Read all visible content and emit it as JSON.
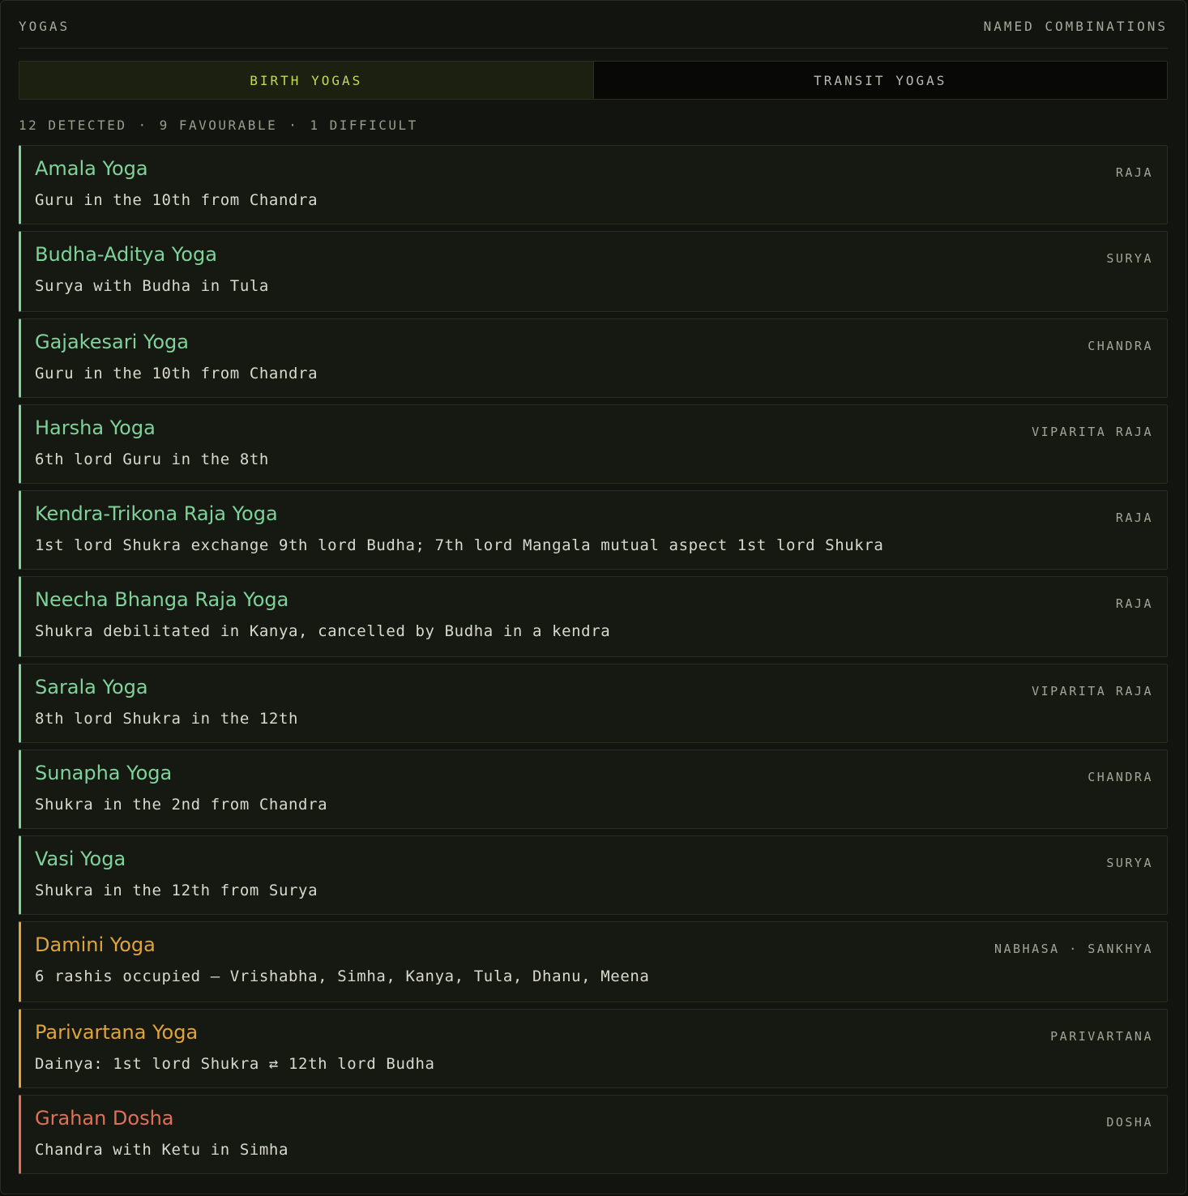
{
  "header": {
    "title": "YOGAS",
    "subtitle": "NAMED COMBINATIONS"
  },
  "tabs": [
    {
      "label": "BIRTH YOGAS",
      "active": true
    },
    {
      "label": "TRANSIT YOGAS",
      "active": false
    }
  ],
  "summary": {
    "detected": "12 DETECTED",
    "favourable": "9 FAVOURABLE",
    "difficult": "1 DIFFICULT",
    "separator": "·"
  },
  "colors": {
    "favourable": "#7fd39a",
    "mixed": "#e0a43c",
    "difficult": "#e0705a",
    "active_tab": "#c6d854"
  },
  "yogas": [
    {
      "name": "Amala Yoga",
      "description": "Guru in the 10th from Chandra",
      "tag": "RAJA",
      "kind": "good"
    },
    {
      "name": "Budha-Aditya Yoga",
      "description": "Surya with Budha in Tula",
      "tag": "SURYA",
      "kind": "good"
    },
    {
      "name": "Gajakesari Yoga",
      "description": "Guru in the 10th from Chandra",
      "tag": "CHANDRA",
      "kind": "good"
    },
    {
      "name": "Harsha Yoga",
      "description": "6th lord Guru in the 8th",
      "tag": "VIPARITA RAJA",
      "kind": "good"
    },
    {
      "name": "Kendra-Trikona Raja Yoga",
      "description": "1st lord Shukra exchange 9th lord Budha; 7th lord Mangala mutual aspect 1st lord Shukra",
      "tag": "RAJA",
      "kind": "good"
    },
    {
      "name": "Neecha Bhanga Raja Yoga",
      "description": "Shukra debilitated in Kanya, cancelled by Budha in a kendra",
      "tag": "RAJA",
      "kind": "good"
    },
    {
      "name": "Sarala Yoga",
      "description": "8th lord Shukra in the 12th",
      "tag": "VIPARITA RAJA",
      "kind": "good"
    },
    {
      "name": "Sunapha Yoga",
      "description": "Shukra in the 2nd from Chandra",
      "tag": "CHANDRA",
      "kind": "good"
    },
    {
      "name": "Vasi Yoga",
      "description": "Shukra in the 12th from Surya",
      "tag": "SURYA",
      "kind": "good"
    },
    {
      "name": "Damini Yoga",
      "description": "6 rashis occupied — Vrishabha, Simha, Kanya, Tula, Dhanu, Meena",
      "tag": "NABHASA · SANKHYA",
      "kind": "mixed"
    },
    {
      "name": "Parivartana Yoga",
      "description": "Dainya: 1st lord Shukra ⇄ 12th lord Budha",
      "tag": "PARIVARTANA",
      "kind": "mixed"
    },
    {
      "name": "Grahan Dosha",
      "description": "Chandra with Ketu in Simha",
      "tag": "DOSHA",
      "kind": "bad"
    }
  ]
}
